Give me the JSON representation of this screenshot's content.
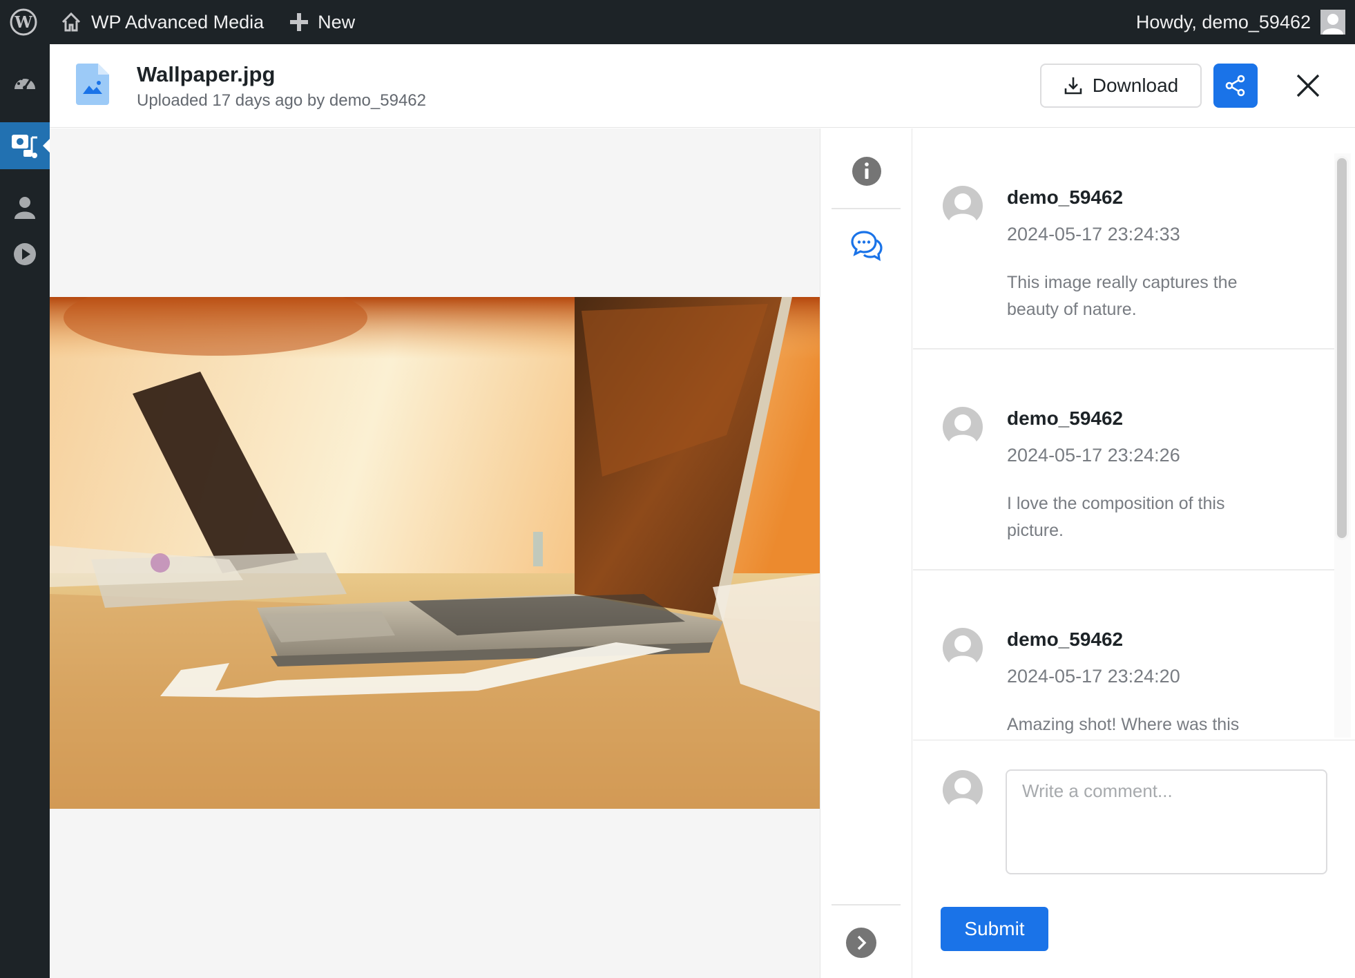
{
  "adminbar": {
    "site_name": "WP Advanced Media",
    "new_label": "New",
    "greeting": "Howdy, demo_59462"
  },
  "file": {
    "name": "Wallpaper.jpg",
    "uploaded": "Uploaded 17 days ago by demo_59462"
  },
  "toolbar": {
    "download_label": "Download"
  },
  "comments": [
    {
      "author": "demo_59462",
      "date": "2024-05-17 23:24:33",
      "text": "This image really captures the beauty of nature."
    },
    {
      "author": "demo_59462",
      "date": "2024-05-17 23:24:26",
      "text": "I love the composition of this picture."
    },
    {
      "author": "demo_59462",
      "date": "2024-05-17 23:24:20",
      "text": "Amazing shot! Where was this"
    }
  ],
  "compose": {
    "placeholder": "Write a comment...",
    "submit_label": "Submit"
  },
  "colors": {
    "admin_bar": "#1d2327",
    "accent": "#1a73e8",
    "active_menu": "#2271b1"
  },
  "icons": {
    "sidebar": [
      "dashboard-icon",
      "media-icon",
      "users-icon",
      "play-icon"
    ],
    "rail": [
      "info-icon",
      "comments-icon",
      "expand-icon"
    ]
  }
}
